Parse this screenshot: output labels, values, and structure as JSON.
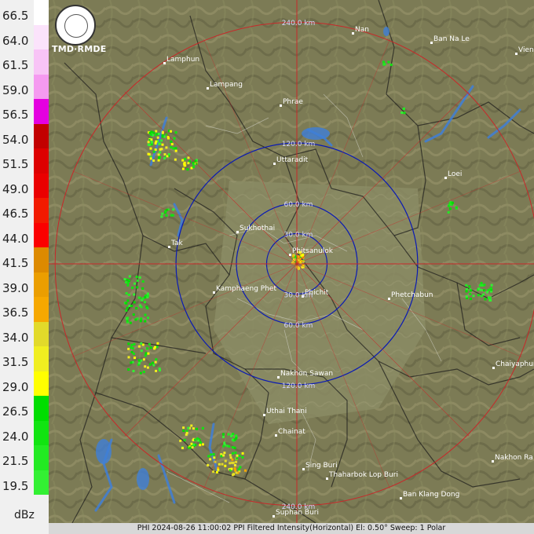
{
  "legend": {
    "unit": "dBz",
    "levels": [
      {
        "label": "66.5",
        "color": "#ffffff"
      },
      {
        "label": "64.0",
        "color": "#fbe3fb"
      },
      {
        "label": "61.5",
        "color": "#f8c4f6"
      },
      {
        "label": "59.0",
        "color": "#f59af0"
      },
      {
        "label": "56.5",
        "color": "#e400e0"
      },
      {
        "label": "54.0",
        "color": "#c20000"
      },
      {
        "label": "51.5",
        "color": "#dd0000"
      },
      {
        "label": "49.0",
        "color": "#ea0000"
      },
      {
        "label": "46.5",
        "color": "#f21a00"
      },
      {
        "label": "44.0",
        "color": "#fb0000"
      },
      {
        "label": "41.5",
        "color": "#dd8a00"
      },
      {
        "label": "39.0",
        "color": "#eb9e00"
      },
      {
        "label": "36.5",
        "color": "#f6a800"
      },
      {
        "label": "34.0",
        "color": "#e2da2a"
      },
      {
        "label": "31.5",
        "color": "#f0ee20"
      },
      {
        "label": "29.0",
        "color": "#ffff00"
      },
      {
        "label": "26.5",
        "color": "#00dd00"
      },
      {
        "label": "24.0",
        "color": "#11e411"
      },
      {
        "label": "21.5",
        "color": "#22ea22"
      },
      {
        "label": "19.5",
        "color": "#33f033"
      }
    ]
  },
  "logo_text": "TMD·RMDE",
  "status_bar": "PHI 2024-08-26 11:00:02 PPI Filtered Intensity(Horizontal)  El: 0.50°  Sweep: 1 Polar",
  "range_rings": [
    {
      "label": "30.0 km"
    },
    {
      "label": "60.0 km"
    },
    {
      "label": "120.0 km"
    },
    {
      "label": "240.0 km"
    }
  ],
  "range_labels": [
    {
      "text": "240.0 km",
      "ring": 240,
      "side": "top"
    },
    {
      "text": "120.0 km",
      "ring": 120,
      "side": "top"
    },
    {
      "text": "60.0 km",
      "ring": 60,
      "side": "top"
    },
    {
      "text": "30.0 km",
      "ring": 30,
      "side": "top"
    },
    {
      "text": "30.0 km",
      "ring": 30,
      "side": "bottom"
    },
    {
      "text": "60.0 km",
      "ring": 60,
      "side": "bottom"
    },
    {
      "text": "120.0 km",
      "ring": 120,
      "side": "bottom"
    },
    {
      "text": "240.0 km",
      "ring": 240,
      "side": "bottom"
    }
  ],
  "cities": [
    {
      "name": "Nan"
    },
    {
      "name": "Ban Na Le"
    },
    {
      "name": "Vien"
    },
    {
      "name": "Lamphun"
    },
    {
      "name": "Lampang"
    },
    {
      "name": "Phrae"
    },
    {
      "name": "Uttaradit"
    },
    {
      "name": "Loei"
    },
    {
      "name": "Sukhothai"
    },
    {
      "name": "Phitsanulok"
    },
    {
      "name": "Tak"
    },
    {
      "name": "Kamphaeng Phet"
    },
    {
      "name": "Phichit"
    },
    {
      "name": "Phetchabun"
    },
    {
      "name": "Nakhon Sawan"
    },
    {
      "name": "Chaiyaphum"
    },
    {
      "name": "Uthai Thani"
    },
    {
      "name": "Chainat"
    },
    {
      "name": "Sing Buri"
    },
    {
      "name": "Thaharbok Lop Buri"
    },
    {
      "name": "Nakhon Ra"
    },
    {
      "name": "Ban Klang Dong"
    },
    {
      "name": "Suphan Buri"
    }
  ],
  "colors": {
    "terrain": "#7c7b55",
    "ring": "#0a1ab4",
    "outer_ring": "#c8282a",
    "city": "#ffffff",
    "river": "#3f7fd8",
    "border": "#1a1a1a"
  }
}
